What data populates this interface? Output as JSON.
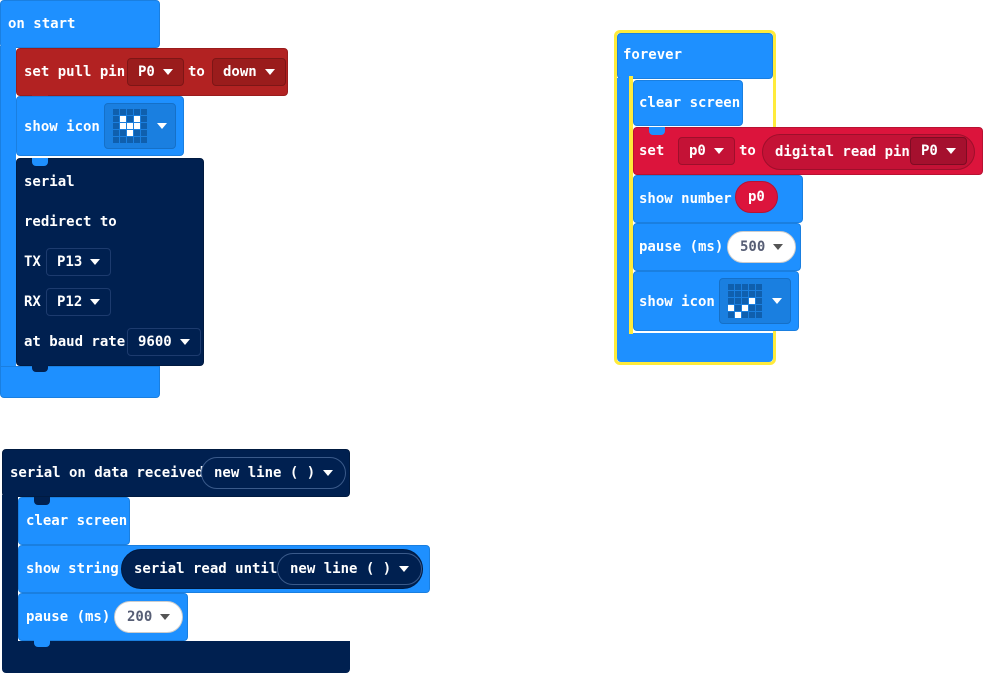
{
  "on_start": {
    "hat_label": "on start",
    "pull": {
      "label": "set pull pin",
      "pin": "P0",
      "to": "to",
      "mode": "down"
    },
    "show_icon": {
      "label": "show icon",
      "icon": "heart-icon",
      "leds": [
        0,
        0,
        0,
        0,
        0,
        0,
        1,
        0,
        1,
        0,
        0,
        1,
        1,
        1,
        0,
        0,
        0,
        1,
        0,
        0,
        0,
        0,
        0,
        0,
        0
      ]
    },
    "serial": {
      "line1": "serial",
      "line2": "redirect to",
      "tx_label": "TX",
      "tx_value": "P13",
      "rx_label": "RX",
      "rx_value": "P12",
      "baud_label": "at baud rate",
      "baud_value": "9600"
    }
  },
  "forever": {
    "hat_label": "forever",
    "clear_screen": "clear screen",
    "set": {
      "label": "set",
      "var": "p0",
      "to": "to",
      "reporter": "digital read pin",
      "pin": "P0"
    },
    "show_number": {
      "label": "show number",
      "value": "p0"
    },
    "pause": {
      "label": "pause (ms)",
      "value": "500"
    },
    "show_icon": {
      "label": "show icon",
      "icon": "small-checkmark-icon",
      "leds": [
        0,
        0,
        0,
        0,
        0,
        0,
        0,
        0,
        0,
        0,
        0,
        0,
        0,
        1,
        0,
        1,
        0,
        1,
        0,
        0,
        0,
        1,
        0,
        0,
        0
      ]
    }
  },
  "serial_handler": {
    "hat_label": "serial on data received",
    "delimiter": "new line ( )",
    "clear_screen": "clear screen",
    "show_string": {
      "label": "show string",
      "reporter": "serial read until",
      "delimiter": "new line ( )"
    },
    "pause": {
      "label": "pause (ms)",
      "value": "200"
    }
  },
  "colors": {
    "basic_blue": "#1e90ff",
    "pins_red": "#b22222",
    "variable_crimson": "#dc143c",
    "serial_navy": "#002050",
    "selection_yellow": "#ffeb3b"
  }
}
